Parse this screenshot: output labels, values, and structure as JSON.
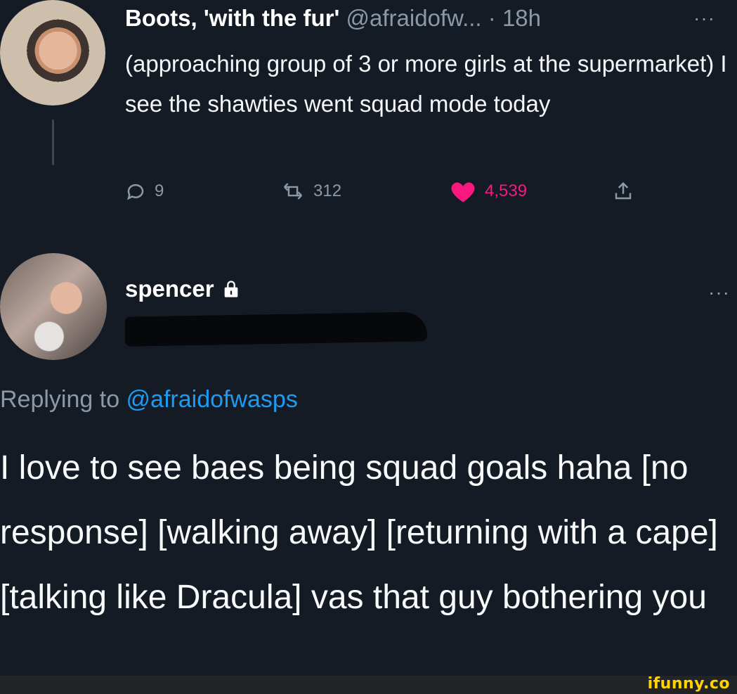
{
  "colors": {
    "background": "#151b24",
    "primary_text": "#ffffff",
    "secondary_text": "#8b98a5",
    "link_blue": "#1d9bf0",
    "like_pink": "#f91880",
    "watermark_yellow": "#ffd400"
  },
  "original_tweet": {
    "display_name": "Boots, 'with the fur'",
    "handle": "@afraidofw...",
    "separator": "·",
    "time": "18h",
    "more": "···",
    "text": "(approaching group of 3 or more girls at the supermarket) I see the shawties went squad mode today",
    "actions": {
      "reply_icon": "reply-icon",
      "reply_count": "9",
      "retweet_icon": "retweet-icon",
      "retweet_count": "312",
      "like_icon": "heart-filled-icon",
      "like_count": "4,539",
      "share_icon": "share-icon"
    }
  },
  "reply_tweet": {
    "display_name": "spencer",
    "lock_icon": "lock-icon",
    "more": "···",
    "reply_context_prefix": "Replying to ",
    "reply_context_handle": "@afraidofwasps",
    "text": "I love to see baes being squad goals haha [no response] [walking away] [returning with a cape] [talking like Dracula] vas that guy bothering you"
  },
  "watermark": {
    "text": "ifunny.co"
  }
}
